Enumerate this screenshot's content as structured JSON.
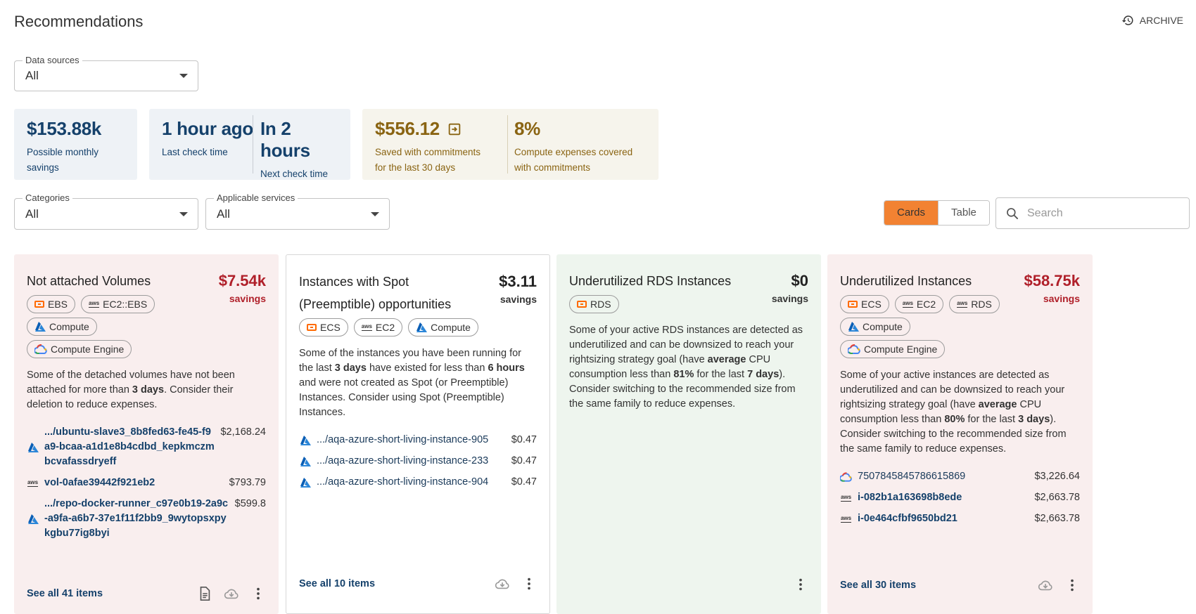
{
  "header": {
    "title": "Recommendations",
    "archive_label": "ARCHIVE"
  },
  "filters": {
    "data_sources": {
      "legend": "Data sources",
      "value": "All"
    },
    "categories": {
      "legend": "Categories",
      "value": "All"
    },
    "services": {
      "legend": "Applicable services",
      "value": "All"
    }
  },
  "summary": {
    "savings_value": "$153.88k",
    "savings_label": "Possible monthly savings",
    "last_check_value": "1 hour ago",
    "last_check_label": "Last check time",
    "next_check_value": "In 2 hours",
    "next_check_label": "Next check time",
    "commitment_value": "$556.12",
    "commitment_label": "Saved with commitments for the last 30 days",
    "coverage_value": "8%",
    "coverage_label": "Compute expenses covered with commitments"
  },
  "view": {
    "cards_label": "Cards",
    "table_label": "Table",
    "search_placeholder": "Search"
  },
  "cards": [
    {
      "title": "Not attached Volumes",
      "amount": "$7.54k",
      "amount_label": "savings",
      "chips": [
        "EBS",
        "EC2::EBS",
        "Compute",
        "Compute Engine"
      ],
      "desc_1": "Some of the detached volumes have not been attached for more than ",
      "desc_b1": "3 days",
      "desc_2": ". Consider their deletion to reduce expenses.",
      "items": [
        {
          "name": ".../ubuntu-slave3_8b8fed63-fe45-f9a9-bcaa-a1d1e8b4cdbd_kepkmczmbcvafassdryeff",
          "cost": "$2,168.24"
        },
        {
          "name": "vol-0afae39442f921eb2",
          "cost": "$793.79"
        },
        {
          "name": ".../repo-docker-runner_c97e0b19-2a9c-a9fa-a6b7-37e1f11f2bb9_9wytopsxpykgbu77ig8byi",
          "cost": "$599.8"
        }
      ],
      "see_all": "See all 41 items"
    },
    {
      "title": "Instances with Spot (Preemptible) opportunities",
      "amount": "$3.11",
      "amount_label": "savings",
      "chips": [
        "ECS",
        "EC2",
        "Compute"
      ],
      "desc_1": "Some of the instances you have been running for the last ",
      "desc_b1": "3 days",
      "desc_2": " have existed for less than ",
      "desc_b2": "6 hours",
      "desc_3": " and were not created as Spot (or Preemptible) Instances. Consider using Spot (Preemptible) Instances.",
      "items": [
        {
          "name": ".../aqa-azure-short-living-instance-905",
          "cost": "$0.47"
        },
        {
          "name": ".../aqa-azure-short-living-instance-233",
          "cost": "$0.47"
        },
        {
          "name": ".../aqa-azure-short-living-instance-904",
          "cost": "$0.47"
        }
      ],
      "see_all": "See all 10 items"
    },
    {
      "title": "Underutilized RDS Instances",
      "amount": "$0",
      "amount_label": "savings",
      "chips": [
        "RDS"
      ],
      "desc_1": "Some of your active RDS instances are detected as underutilized and can be downsized to reach your rightsizing strategy goal (have ",
      "desc_b1": "average",
      "desc_2": " CPU consumption less than ",
      "desc_b2": "81%",
      "desc_3": " for the last ",
      "desc_b3": "7 days",
      "desc_4": "). Consider switching to the recommended size from the same family to reduce expenses."
    },
    {
      "title": "Underutilized Instances",
      "amount": "$58.75k",
      "amount_label": "savings",
      "chips": [
        "ECS",
        "EC2",
        "RDS",
        "Compute",
        "Compute Engine"
      ],
      "desc_1": "Some of your active instances are detected as underutilized and can be downsized to reach your rightsizing strategy goal (have ",
      "desc_b1": "average",
      "desc_2": " CPU consumption less than ",
      "desc_b2": "80%",
      "desc_3": " for the last ",
      "desc_b3": "3 days",
      "desc_4": "). Consider switching to the recommended size from the same family to reduce expenses.",
      "items": [
        {
          "name": "7507845845786615869",
          "cost": "$3,226.64"
        },
        {
          "name": "i-082b1a163698b8ede",
          "cost": "$2,663.78"
        },
        {
          "name": "i-0e464cfbf9650bd21",
          "cost": "$2,663.78"
        }
      ],
      "see_all": "See all 30 items"
    }
  ],
  "colors": {
    "accent": "#f28232",
    "savings_red": "#b0202a",
    "navy": "#15416b",
    "gold": "#8a6412"
  },
  "icons": {
    "archive": "history-icon",
    "search": "search-icon",
    "azure": "azure-icon",
    "aws": "aws-icon",
    "alibaba": "alibaba-icon",
    "gcp": "gcp-icon",
    "download": "cloud-download-icon",
    "menu": "more-vert-icon",
    "doc": "document-icon"
  }
}
